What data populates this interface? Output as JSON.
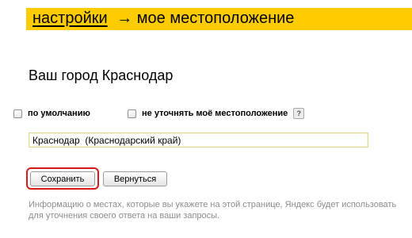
{
  "header": {
    "settings_link": "настройки",
    "arrow": "→",
    "title": "мое местоположение",
    "bg_color": "#ffcc00"
  },
  "city": {
    "label": "Ваш город Краснодар"
  },
  "options": {
    "default_label": "по умолчанию",
    "default_checked": false,
    "no_refine_label": "не уточнять моё местоположение",
    "no_refine_checked": false,
    "help_icon": "?"
  },
  "location_input": {
    "value": "Краснодар  (Краснодарский край)"
  },
  "buttons": {
    "save": "Сохранить",
    "back": "Вернуться",
    "highlight_color": "#d61a1a"
  },
  "info": {
    "text": "Информацию о местах, которые вы укажете на этой странице, Яндекс будет использовать для уточнения своего ответа на ваши запросы."
  }
}
